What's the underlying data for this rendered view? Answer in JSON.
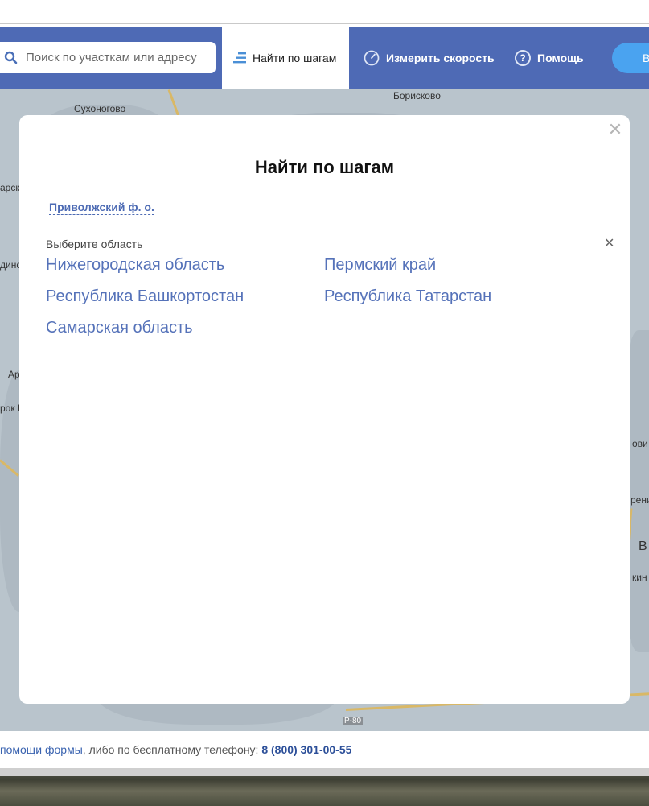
{
  "nav": {
    "search_placeholder": "Поиск по участкам или адресу",
    "tab_steps": "Найти по шагам",
    "speed_label": "Измерить скорость",
    "help_label": "Помощь",
    "help_icon_glyph": "?",
    "login_label": "В"
  },
  "map": {
    "labels": [
      "Сухоногово",
      "Борисково",
      "арск",
      "Р-80",
      "Ар",
      "динс",
      "рок К",
      "рени",
      "ови",
      "кин",
      "В"
    ]
  },
  "modal": {
    "close_glyph": "✕",
    "title": "Найти по шагам",
    "breadcrumb": "Приволжский ф. о.",
    "prompt": "Выберите область",
    "clear_glyph": "✕",
    "regions": [
      "Нижегородская область",
      "Пермский край",
      "Республика Башкортостан",
      "Республика Татарстан",
      "Самарская область"
    ]
  },
  "footer": {
    "link_text": "помощи формы",
    "mid_text": ", либо по бесплатному телефону: ",
    "phone": "8 (800) 301-00-55"
  },
  "colors": {
    "nav_bg": "#4e6ab5",
    "link": "#5572b9",
    "phone": "#2c4f99",
    "login_pill": "#4aa3f0"
  }
}
